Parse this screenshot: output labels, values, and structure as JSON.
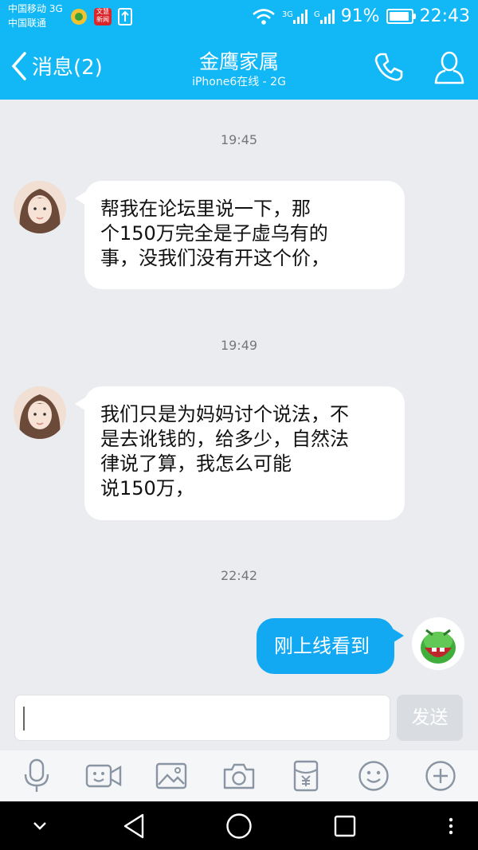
{
  "status_bar": {
    "carrier1": "中国移动 3G",
    "carrier2": "中国联通",
    "app_badge": "文慧\n新闻",
    "net1": "3G",
    "net2": "G",
    "battery": "91%",
    "time": "22:43"
  },
  "header": {
    "back_label": "消息(2)",
    "title": "金鹰家属",
    "subtitle": "iPhone6在线 - 2G"
  },
  "messages": [
    {
      "time": "19:45",
      "lines": [
        "帮我在论坛里说一下，那",
        "个150万完全是子虚乌有的",
        "事，没我们没有开这个价，"
      ]
    },
    {
      "time": "19:49",
      "lines": [
        "我们只是为妈妈讨个说法，不",
        "是去讹钱的，给多少，自然法",
        "律说了算，我怎么可能",
        "说150万，"
      ]
    },
    {
      "time": "22:42",
      "text": "刚上线看到"
    }
  ],
  "input": {
    "send_label": "发送"
  },
  "colors": {
    "accent": "#12b7f5",
    "bubble_me": "#12a8f2",
    "background": "#eaecf0"
  },
  "icons": {
    "toolbar": [
      "microphone-icon",
      "video-icon",
      "image-icon",
      "camera-icon",
      "red-packet-icon",
      "emoji-icon",
      "plus-icon"
    ],
    "nav": [
      "chevron-down-icon",
      "back-triangle-icon",
      "home-circle-icon",
      "recents-square-icon",
      "more-dots-icon"
    ]
  }
}
